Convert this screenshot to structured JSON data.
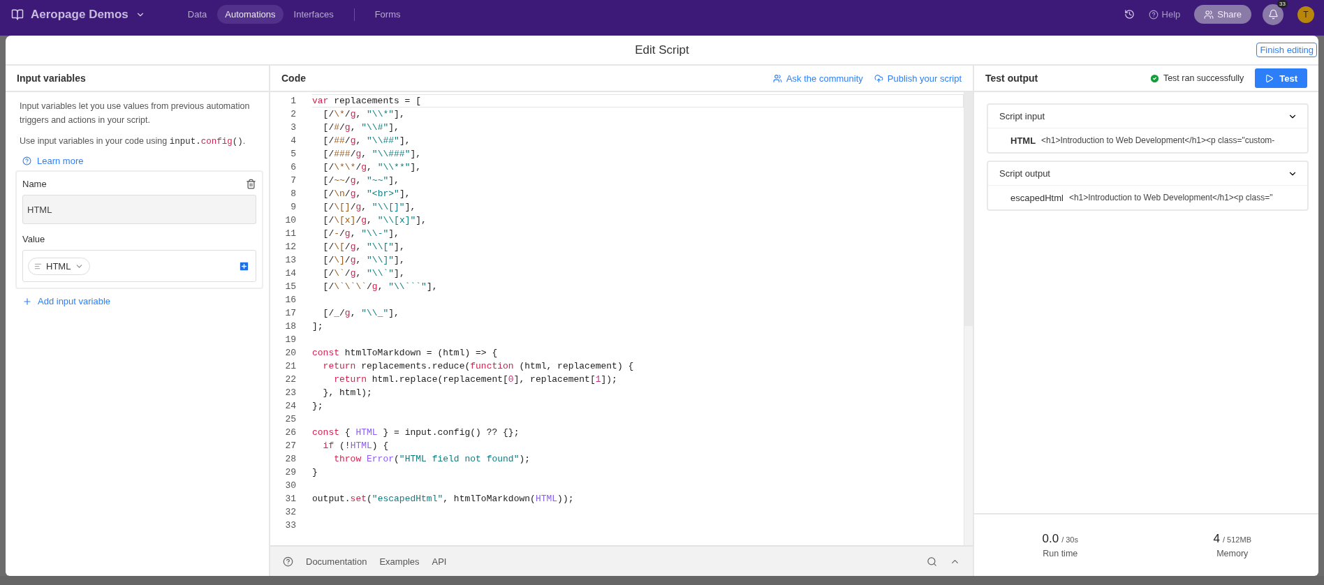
{
  "top_bar": {
    "workspace": "Aeropage Demos",
    "nav": [
      {
        "label": "Data",
        "selected": false
      },
      {
        "label": "Automations",
        "selected": true
      },
      {
        "label": "Interfaces",
        "selected": false
      },
      {
        "label": "Forms",
        "selected": false
      }
    ],
    "help": "Help",
    "share": "Share",
    "notifications": "33",
    "avatar": "T"
  },
  "dialog": {
    "title": "Edit Script",
    "finish": "Finish editing"
  },
  "input_panel": {
    "title": "Input variables",
    "description": "Input variables let you use values from previous automation triggers and actions in your script.",
    "usage": {
      "text": "Use input variables in your code using ",
      "code": [
        {
          "text": "input.",
          "kind": "plain"
        },
        {
          "text": "config",
          "kind": "keyword"
        },
        {
          "text": "()",
          "kind": "plain"
        }
      ],
      "end": "."
    },
    "learn_more": "Learn more",
    "variables": [
      {
        "name_label": "Name",
        "name": "HTML",
        "value_label": "Value",
        "value": "HTML"
      }
    ],
    "add": "Add input variable"
  },
  "code_panel": {
    "title": "Code",
    "actions": [
      "Ask the community",
      "Publish your script"
    ],
    "lines": [
      {
        "number": "1",
        "active": true,
        "tokens": [
          {
            "text": "var",
            "kind": "keyword"
          },
          {
            "text": " replacements = [",
            "kind": "plain"
          }
        ]
      },
      {
        "number": "2",
        "active": false,
        "tokens": [
          {
            "text": "  [/",
            "kind": "plain"
          },
          {
            "text": "\\*",
            "kind": "regex"
          },
          {
            "text": "/",
            "kind": "plain"
          },
          {
            "text": "g",
            "kind": "flag"
          },
          {
            "text": ", ",
            "kind": "plain"
          },
          {
            "text": "\"\\\\*\"",
            "kind": "string"
          },
          {
            "text": "],",
            "kind": "plain"
          }
        ]
      },
      {
        "number": "3",
        "active": false,
        "tokens": [
          {
            "text": "  [/",
            "kind": "plain"
          },
          {
            "text": "#",
            "kind": "regex"
          },
          {
            "text": "/",
            "kind": "plain"
          },
          {
            "text": "g",
            "kind": "flag"
          },
          {
            "text": ", ",
            "kind": "plain"
          },
          {
            "text": "\"\\\\#\"",
            "kind": "string"
          },
          {
            "text": "],",
            "kind": "plain"
          }
        ]
      },
      {
        "number": "4",
        "active": false,
        "tokens": [
          {
            "text": "  [/",
            "kind": "plain"
          },
          {
            "text": "##",
            "kind": "regex"
          },
          {
            "text": "/",
            "kind": "plain"
          },
          {
            "text": "g",
            "kind": "flag"
          },
          {
            "text": ", ",
            "kind": "plain"
          },
          {
            "text": "\"\\\\##\"",
            "kind": "string"
          },
          {
            "text": "],",
            "kind": "plain"
          }
        ]
      },
      {
        "number": "5",
        "active": false,
        "tokens": [
          {
            "text": "  [/",
            "kind": "plain"
          },
          {
            "text": "###",
            "kind": "regex"
          },
          {
            "text": "/",
            "kind": "plain"
          },
          {
            "text": "g",
            "kind": "flag"
          },
          {
            "text": ", ",
            "kind": "plain"
          },
          {
            "text": "\"\\\\###\"",
            "kind": "string"
          },
          {
            "text": "],",
            "kind": "plain"
          }
        ]
      },
      {
        "number": "6",
        "active": false,
        "tokens": [
          {
            "text": "  [/",
            "kind": "plain"
          },
          {
            "text": "\\*\\*",
            "kind": "regex"
          },
          {
            "text": "/",
            "kind": "plain"
          },
          {
            "text": "g",
            "kind": "flag"
          },
          {
            "text": ", ",
            "kind": "plain"
          },
          {
            "text": "\"\\\\**\"",
            "kind": "string"
          },
          {
            "text": "],",
            "kind": "plain"
          }
        ]
      },
      {
        "number": "7",
        "active": false,
        "tokens": [
          {
            "text": "  [/",
            "kind": "plain"
          },
          {
            "text": "~~",
            "kind": "regex"
          },
          {
            "text": "/",
            "kind": "plain"
          },
          {
            "text": "g",
            "kind": "flag"
          },
          {
            "text": ", ",
            "kind": "plain"
          },
          {
            "text": "\"~~\"",
            "kind": "string"
          },
          {
            "text": "],",
            "kind": "plain"
          }
        ]
      },
      {
        "number": "8",
        "active": false,
        "tokens": [
          {
            "text": "  [/",
            "kind": "plain"
          },
          {
            "text": "\\n",
            "kind": "regex"
          },
          {
            "text": "/",
            "kind": "plain"
          },
          {
            "text": "g",
            "kind": "flag"
          },
          {
            "text": ", ",
            "kind": "plain"
          },
          {
            "text": "\"<br>\"",
            "kind": "string"
          },
          {
            "text": "],",
            "kind": "plain"
          }
        ]
      },
      {
        "number": "9",
        "active": false,
        "tokens": [
          {
            "text": "  [/",
            "kind": "plain"
          },
          {
            "text": "\\[]",
            "kind": "regex"
          },
          {
            "text": "/",
            "kind": "plain"
          },
          {
            "text": "g",
            "kind": "flag"
          },
          {
            "text": ", ",
            "kind": "plain"
          },
          {
            "text": "\"\\\\[]\"",
            "kind": "string"
          },
          {
            "text": "],",
            "kind": "plain"
          }
        ]
      },
      {
        "number": "10",
        "active": false,
        "tokens": [
          {
            "text": "  [/",
            "kind": "plain"
          },
          {
            "text": "\\[x]",
            "kind": "regex"
          },
          {
            "text": "/",
            "kind": "plain"
          },
          {
            "text": "g",
            "kind": "flag"
          },
          {
            "text": ", ",
            "kind": "plain"
          },
          {
            "text": "\"\\\\[x]\"",
            "kind": "string"
          },
          {
            "text": "],",
            "kind": "plain"
          }
        ]
      },
      {
        "number": "11",
        "active": false,
        "tokens": [
          {
            "text": "  [/",
            "kind": "plain"
          },
          {
            "text": "-",
            "kind": "regex"
          },
          {
            "text": "/",
            "kind": "plain"
          },
          {
            "text": "g",
            "kind": "flag"
          },
          {
            "text": ", ",
            "kind": "plain"
          },
          {
            "text": "\"\\\\-\"",
            "kind": "string"
          },
          {
            "text": "],",
            "kind": "plain"
          }
        ]
      },
      {
        "number": "12",
        "active": false,
        "tokens": [
          {
            "text": "  [/",
            "kind": "plain"
          },
          {
            "text": "\\[",
            "kind": "regex"
          },
          {
            "text": "/",
            "kind": "plain"
          },
          {
            "text": "g",
            "kind": "flag"
          },
          {
            "text": ", ",
            "kind": "plain"
          },
          {
            "text": "\"\\\\[\"",
            "kind": "string"
          },
          {
            "text": "],",
            "kind": "plain"
          }
        ]
      },
      {
        "number": "13",
        "active": false,
        "tokens": [
          {
            "text": "  [/",
            "kind": "plain"
          },
          {
            "text": "\\]",
            "kind": "regex"
          },
          {
            "text": "/",
            "kind": "plain"
          },
          {
            "text": "g",
            "kind": "flag"
          },
          {
            "text": ", ",
            "kind": "plain"
          },
          {
            "text": "\"\\\\]\"",
            "kind": "string"
          },
          {
            "text": "],",
            "kind": "plain"
          }
        ]
      },
      {
        "number": "14",
        "active": false,
        "tokens": [
          {
            "text": "  [/",
            "kind": "plain"
          },
          {
            "text": "\\`",
            "kind": "regex"
          },
          {
            "text": "/",
            "kind": "plain"
          },
          {
            "text": "g",
            "kind": "flag"
          },
          {
            "text": ", ",
            "kind": "plain"
          },
          {
            "text": "\"\\\\`\"",
            "kind": "string"
          },
          {
            "text": "],",
            "kind": "plain"
          }
        ]
      },
      {
        "number": "15",
        "active": false,
        "tokens": [
          {
            "text": "  [/",
            "kind": "plain"
          },
          {
            "text": "\\`\\`\\`",
            "kind": "regex"
          },
          {
            "text": "/",
            "kind": "plain"
          },
          {
            "text": "g",
            "kind": "flag"
          },
          {
            "text": ", ",
            "kind": "plain"
          },
          {
            "text": "\"\\\\```\"",
            "kind": "string"
          },
          {
            "text": "],",
            "kind": "plain"
          }
        ]
      },
      {
        "number": "16",
        "active": false
      },
      {
        "number": "17",
        "active": false,
        "tokens": [
          {
            "text": "  [/",
            "kind": "plain"
          },
          {
            "text": "_",
            "kind": "regex"
          },
          {
            "text": "/",
            "kind": "plain"
          },
          {
            "text": "g",
            "kind": "flag"
          },
          {
            "text": ", ",
            "kind": "plain"
          },
          {
            "text": "\"\\\\_\"",
            "kind": "string"
          },
          {
            "text": "],",
            "kind": "plain"
          }
        ]
      },
      {
        "number": "18",
        "active": false,
        "tokens": [
          {
            "text": "];",
            "kind": "plain"
          }
        ]
      },
      {
        "number": "19",
        "active": false
      },
      {
        "number": "20",
        "active": false,
        "tokens": [
          {
            "text": "const",
            "kind": "keyword"
          },
          {
            "text": " htmlToMarkdown = (html) => {",
            "kind": "plain"
          }
        ]
      },
      {
        "number": "21",
        "active": false,
        "tokens": [
          {
            "text": "  return",
            "kind": "keyword"
          },
          {
            "text": " replacements.reduce(",
            "kind": "plain"
          },
          {
            "text": "function",
            "kind": "keyword"
          },
          {
            "text": " (html, replacement) {",
            "kind": "plain"
          }
        ]
      },
      {
        "number": "22",
        "active": false,
        "tokens": [
          {
            "text": "    return",
            "kind": "keyword"
          },
          {
            "text": " html.replace(replacement[",
            "kind": "plain"
          },
          {
            "text": "0",
            "kind": "number"
          },
          {
            "text": "], replacement[",
            "kind": "plain"
          },
          {
            "text": "1",
            "kind": "number"
          },
          {
            "text": "]);",
            "kind": "plain"
          }
        ]
      },
      {
        "number": "23",
        "active": false,
        "tokens": [
          {
            "text": "  }, html);",
            "kind": "plain"
          }
        ]
      },
      {
        "number": "24",
        "active": false,
        "tokens": [
          {
            "text": "};",
            "kind": "plain"
          }
        ]
      },
      {
        "number": "25",
        "active": false
      },
      {
        "number": "26",
        "active": false,
        "tokens": [
          {
            "text": "const",
            "kind": "keyword"
          },
          {
            "text": " { ",
            "kind": "plain"
          },
          {
            "text": "HTML",
            "kind": "ident"
          },
          {
            "text": " } = input.config() ?? {};",
            "kind": "plain"
          }
        ]
      },
      {
        "number": "27",
        "active": false,
        "tokens": [
          {
            "text": "  if",
            "kind": "keyword"
          },
          {
            "text": " (!",
            "kind": "plain"
          },
          {
            "text": "HTML",
            "kind": "ident"
          },
          {
            "text": ") {",
            "kind": "plain"
          }
        ]
      },
      {
        "number": "28",
        "active": false,
        "tokens": [
          {
            "text": "    throw ",
            "kind": "keyword"
          },
          {
            "text": "Error",
            "kind": "ident"
          },
          {
            "text": "(",
            "kind": "plain"
          },
          {
            "text": "\"HTML field not found\"",
            "kind": "string"
          },
          {
            "text": ");",
            "kind": "plain"
          }
        ]
      },
      {
        "number": "29",
        "active": false,
        "tokens": [
          {
            "text": "}",
            "kind": "plain"
          }
        ]
      },
      {
        "number": "30",
        "active": false
      },
      {
        "number": "31",
        "active": false,
        "tokens": [
          {
            "text": "output.",
            "kind": "plain"
          },
          {
            "text": "set",
            "kind": "keyword"
          },
          {
            "text": "(",
            "kind": "plain"
          },
          {
            "text": "\"escapedHtml\"",
            "kind": "string"
          },
          {
            "text": ", htmlToMarkdown(",
            "kind": "plain"
          },
          {
            "text": "HTML",
            "kind": "ident"
          },
          {
            "text": "));",
            "kind": "plain"
          }
        ]
      },
      {
        "number": "32",
        "active": false
      },
      {
        "number": "33",
        "active": false
      }
    ],
    "footer_links": [
      "Documentation",
      "Examples",
      "API"
    ]
  },
  "output_panel": {
    "title": "Test output",
    "status": "Test ran successfully",
    "test_button": "Test",
    "sections": [
      {
        "title": "Script input",
        "expanded": true,
        "rows": [
          {
            "key": "HTML",
            "value": "<h1>Introduction to Web Development</h1><p class=\"custom-"
          }
        ]
      },
      {
        "title": "Script output",
        "expanded": true,
        "rows": [
          {
            "key": "escapedHtml",
            "value": "<h1>Introduction to Web Development</h1><p class=\""
          }
        ]
      }
    ],
    "stats": [
      {
        "value": "0.0",
        "limit": "/ 30s",
        "label": "Run time"
      },
      {
        "value": "4",
        "limit": "/ 512MB",
        "label": "Memory"
      }
    ]
  }
}
